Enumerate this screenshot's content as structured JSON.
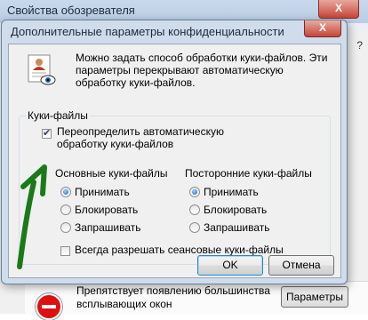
{
  "parent_window": {
    "title": "Свойства обозревателя",
    "close_label": "X",
    "edge_text_a": "?",
    "edge_text_b": "",
    "popup_text": "Препятствует появлению большинства всплывающих окон",
    "params_button": "Параметры"
  },
  "dialog": {
    "title": "Дополнительные параметры конфиденциальности",
    "close_label": "X",
    "intro": "Можно задать способ обработки куки-файлов. Эти параметры перекрывают автоматическую обработку куки-файлов.",
    "group_label": "Куки-файлы",
    "override_label": "Переопределить автоматическую обработку куки-файлов",
    "override_checked": true,
    "first_party": {
      "heading": "Основные куки-файлы",
      "options": [
        "Принимать",
        "Блокировать",
        "Запрашивать"
      ],
      "selected": "Принимать"
    },
    "third_party": {
      "heading": "Посторонние куки-файлы",
      "options": [
        "Принимать",
        "Блокировать",
        "Запрашивать"
      ],
      "selected": "Принимать"
    },
    "session_label": "Всегда разрешать сеансовые куки-файлы",
    "session_checked": false,
    "ok_label": "OK",
    "cancel_label": "Отмена"
  },
  "colors": {
    "annotation_arrow": "#1a7a1a",
    "radio_fill": "#1b5fb4"
  }
}
